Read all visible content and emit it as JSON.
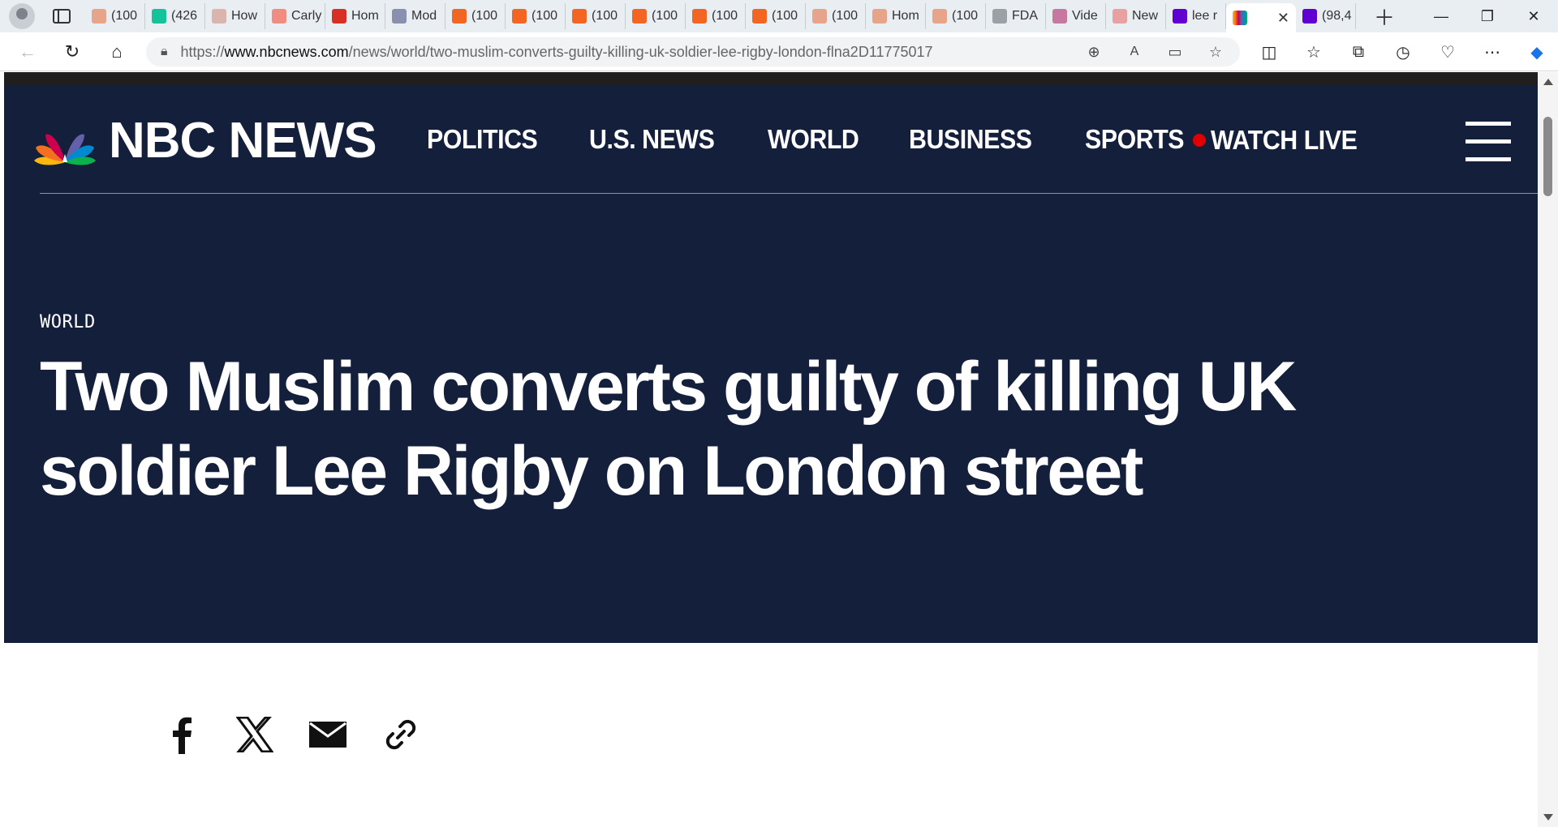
{
  "browser": {
    "tabs": [
      {
        "label": "(100",
        "icon": "bookmark-icon",
        "color": "#e8a48a"
      },
      {
        "label": "(426",
        "icon": "grammarly-icon",
        "color": "#15c39a"
      },
      {
        "label": "How",
        "icon": "bi-icon",
        "color": "#d9b5ae"
      },
      {
        "label": "Carly",
        "icon": "youtube-icon",
        "color": "#f28b82"
      },
      {
        "label": "Hom",
        "icon": "podcast-icon",
        "color": "#d93025"
      },
      {
        "label": "Mod",
        "icon": "text-icon",
        "color": "#8a8fb0"
      },
      {
        "label": "(100",
        "icon": "bookmark-icon",
        "color": "#f26522"
      },
      {
        "label": "(100",
        "icon": "bookmark-icon",
        "color": "#f26522"
      },
      {
        "label": "(100",
        "icon": "bookmark-icon",
        "color": "#f26522"
      },
      {
        "label": "(100",
        "icon": "bookmark-icon",
        "color": "#f26522"
      },
      {
        "label": "(100",
        "icon": "bookmark-icon",
        "color": "#f26522"
      },
      {
        "label": "(100",
        "icon": "bookmark-icon",
        "color": "#f26522"
      },
      {
        "label": "(100",
        "icon": "bookmark-icon",
        "color": "#e8a48a"
      },
      {
        "label": "Hom",
        "icon": "bookmark-icon",
        "color": "#e8a48a"
      },
      {
        "label": "(100",
        "icon": "bookmark-icon",
        "color": "#e8a48a"
      },
      {
        "label": "FDA",
        "icon": "document-icon",
        "color": "#9aa0a6"
      },
      {
        "label": "Vide",
        "icon": "star-icon",
        "color": "#c678a0"
      },
      {
        "label": "New",
        "icon": "r-icon",
        "color": "#e8a0a0"
      },
      {
        "label": "lee r",
        "icon": "yahoo-icon",
        "color": "#6001d2",
        "active": true
      },
      {
        "label": "(98,4",
        "icon": "mail-icon",
        "color": "#6001d2"
      }
    ],
    "active_tab_icon": "nbc-peacock-icon",
    "url_prefix": "https://",
    "url_host": "www.nbcnews.com",
    "url_path": "/news/world/two-muslim-converts-guilty-killing-uk-soldier-lee-rigby-london-flna2D11775017"
  },
  "site": {
    "brand": "NBC NEWS",
    "nav": [
      "POLITICS",
      "U.S. NEWS",
      "WORLD",
      "BUSINESS",
      "SPORTS"
    ],
    "watch_live": "WATCH LIVE",
    "colors": {
      "hero_bg": "#131f3b",
      "live_dot": "#e10000"
    }
  },
  "article": {
    "section": "WORLD",
    "headline": "Two Muslim converts guilty of killing UK soldier Lee Rigby on London street"
  },
  "share": [
    "facebook-icon",
    "x-icon",
    "email-icon",
    "link-icon"
  ]
}
